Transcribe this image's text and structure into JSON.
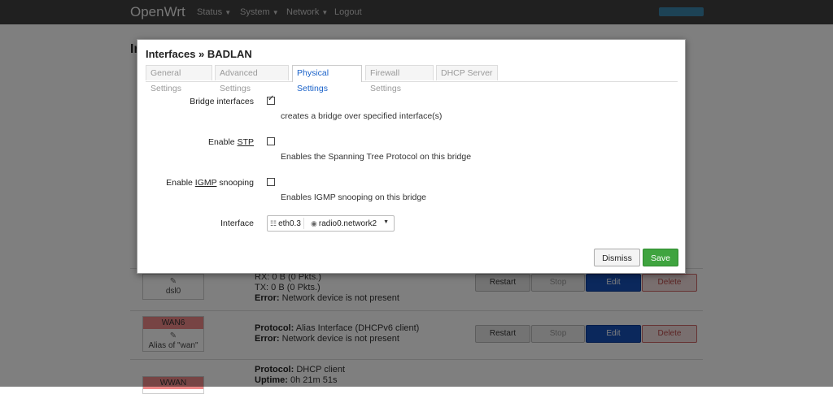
{
  "navbar": {
    "brand": "OpenWrt",
    "items": [
      {
        "label": "Status"
      },
      {
        "label": "System"
      },
      {
        "label": "Network"
      },
      {
        "label": "Logout"
      }
    ]
  },
  "background": {
    "rows": [
      {
        "iface_name": "dsl0",
        "rx": "RX: 0 B (0 Pkts.)",
        "tx": "TX: 0 B (0 Pkts.)",
        "error_label": "Error:",
        "error": "Network device is not present",
        "buttons": {
          "restart": "Restart",
          "stop": "Stop",
          "edit": "Edit",
          "delete": "Delete"
        }
      },
      {
        "badge": "WAN6",
        "iface_name": "Alias of \"wan\"",
        "protocol_label": "Protocol:",
        "protocol": "Alias Interface (DHCPv6 client)",
        "error_label": "Error:",
        "error": "Network device is not present",
        "buttons": {
          "restart": "Restart",
          "stop": "Stop",
          "edit": "Edit",
          "delete": "Delete"
        }
      },
      {
        "badge": "WWAN",
        "protocol_label": "Protocol:",
        "protocol": "DHCP client",
        "uptime_label": "Uptime:",
        "uptime": "0h 21m 51s"
      }
    ]
  },
  "modal": {
    "title": "Interfaces » BADLAN",
    "tabs": [
      {
        "label": "General Settings",
        "active": false
      },
      {
        "label": "Advanced Settings",
        "active": false
      },
      {
        "label": "Physical Settings",
        "active": true
      },
      {
        "label": "Firewall Settings",
        "active": false
      },
      {
        "label": "DHCP Server",
        "active": false
      }
    ],
    "fields": {
      "bridge": {
        "label": "Bridge interfaces",
        "checked": true,
        "description": "creates a bridge over specified interface(s)"
      },
      "stp": {
        "label_prefix": "Enable ",
        "label_abbr": "STP",
        "checked": false,
        "description": "Enables the Spanning Tree Protocol on this bridge"
      },
      "igmp": {
        "label_prefix": "Enable ",
        "label_abbr": "IGMP",
        "label_suffix": " snooping",
        "checked": false,
        "description": "Enables IGMP snooping on this bridge"
      },
      "interface": {
        "label": "Interface",
        "selected": [
          "eth0.3",
          "radio0.network2"
        ]
      }
    },
    "buttons": {
      "dismiss": "Dismiss",
      "save": "Save"
    }
  },
  "colors": {
    "save": "#3fa43f",
    "active_tab": "#1a62c9",
    "edit": "#1650b8",
    "navbar": "#404040"
  },
  "icons": {
    "checkbox_tick": "✓",
    "ethernet": "ethernet-port-icon",
    "wireless": "wireless-icon",
    "dropdown": "caret-down-icon"
  }
}
